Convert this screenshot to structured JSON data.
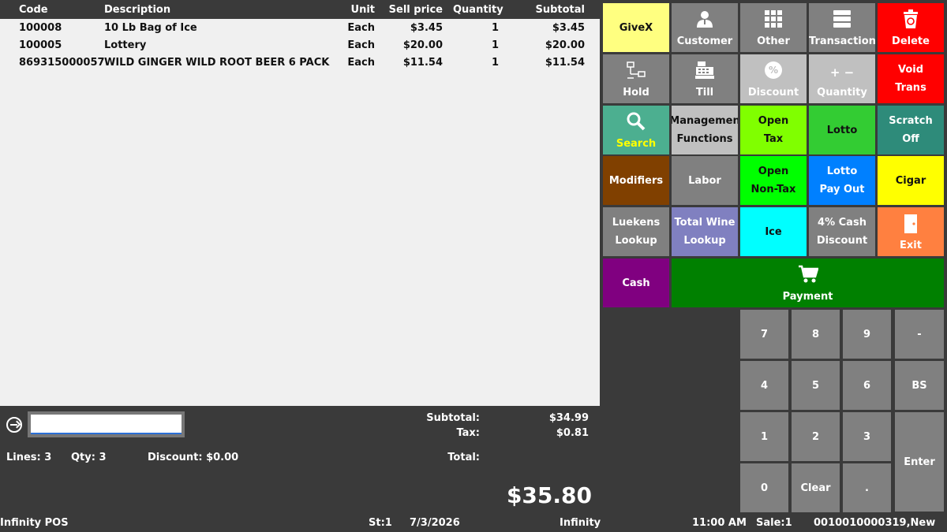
{
  "grid": {
    "headers": {
      "code": "Code",
      "description": "Description",
      "unit": "Unit",
      "sell_price": "Sell price",
      "quantity": "Quantity",
      "subtotal": "Subtotal"
    },
    "rows": [
      {
        "code": "100008",
        "description": "10 Lb Bag of Ice",
        "unit": "Each",
        "sell_price": "$3.45",
        "quantity": "1",
        "subtotal": "$3.45"
      },
      {
        "code": "100005",
        "description": "Lottery",
        "unit": "Each",
        "sell_price": "$20.00",
        "quantity": "1",
        "subtotal": "$20.00"
      },
      {
        "code": "869315000057",
        "description": "WILD GINGER WILD ROOT BEER 6 PACK",
        "unit": "Each",
        "sell_price": "$11.54",
        "quantity": "1",
        "subtotal": "$11.54"
      }
    ]
  },
  "entry": {
    "value": "",
    "placeholder": ""
  },
  "summary": {
    "lines": "Lines: 3",
    "qty": "Qty: 3",
    "discount": "Discount: $0.00",
    "subtotal_label": "Subtotal:",
    "subtotal_value": "$34.99",
    "tax_label": "Tax:",
    "tax_value": "$0.81",
    "total_label": "Total:",
    "grand_total": "$35.80"
  },
  "buttons": {
    "givex": "GiveX",
    "customer": "Customer",
    "other": "Other",
    "transaction": "Transaction",
    "delete": "Delete",
    "hold": "Hold",
    "till": "Till",
    "discount": "Discount",
    "quantity": "Quantity",
    "void_trans_1": "Void",
    "void_trans_2": "Trans",
    "search": "Search",
    "management_1": "Managemen",
    "management_2": "Functions",
    "open_tax_1": "Open",
    "open_tax_2": "Tax",
    "lotto": "Lotto",
    "scratch_1": "Scratch",
    "scratch_2": "Off",
    "modifiers": "Modifiers",
    "labor": "Labor",
    "open_nontax_1": "Open",
    "open_nontax_2": "Non-Tax",
    "lotto_payout_1": "Lotto",
    "lotto_payout_2": "Pay Out",
    "cigar": "Cigar",
    "luekens_1": "Luekens",
    "luekens_2": "Lookup",
    "totalwine_1": "Total Wine",
    "totalwine_2": "Lookup",
    "ice": "Ice",
    "cash_discount_1": "4% Cash",
    "cash_discount_2": "Discount",
    "exit": "Exit",
    "cash": "Cash",
    "payment": "Payment",
    "plus_minus": "+ −"
  },
  "keypad": {
    "k7": "7",
    "k8": "8",
    "k9": "9",
    "kminus": "-",
    "k4": "4",
    "k5": "5",
    "k6": "6",
    "kbs": "BS",
    "k1": "1",
    "k2": "2",
    "k3": "3",
    "kenter": "Enter",
    "k0": "0",
    "kclear": "Clear",
    "kdot": "."
  },
  "colors": {
    "yellow_light": "#ffff80",
    "gray": "#808080",
    "red": "#ff0000",
    "teal": "#4caf90",
    "light_gray": "#c0c0c0",
    "lime": "#80ff00",
    "green": "#33cc33",
    "dark_teal": "#2e8b7a",
    "brown": "#804000",
    "bright_green": "#00ff00",
    "blue": "#0080ff",
    "yellow": "#ffff00",
    "purple_blue": "#8080c0",
    "cyan": "#00ffff",
    "orange": "#ff8040",
    "purple": "#800080",
    "dark_green": "#008000"
  },
  "statusbar": {
    "app": "Infinity POS",
    "station": "St:1",
    "date": "7/3/2026",
    "store": "Infinity",
    "time": "11:00 AM",
    "sale": "Sale:1",
    "txn": "0010010000319,New"
  }
}
